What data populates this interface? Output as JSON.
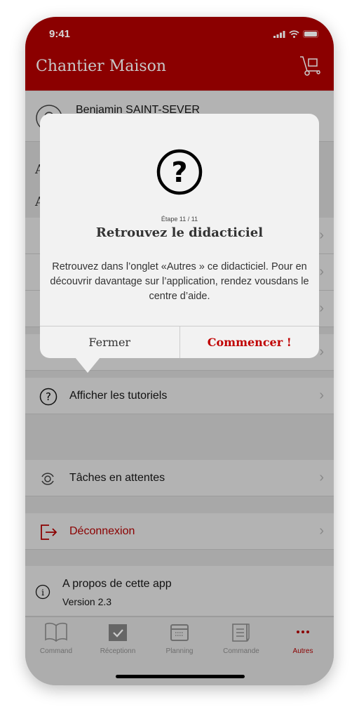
{
  "status": {
    "time": "9:41"
  },
  "header": {
    "title": "Chantier Maison",
    "cart_icon": "cart-icon"
  },
  "user": {
    "name": "Benjamin SAINT-SEVER"
  },
  "sections": [
    "A",
    "A"
  ],
  "menu": {
    "tutorials": "Afficher les tutoriels",
    "pending": "Tâches en attentes",
    "logout": "Déconnexion",
    "about": "A propos de cette app",
    "version": "Version 2.3"
  },
  "dialog": {
    "step": "Étape 11 / 11",
    "title": "Retrouvez le didacticiel",
    "body": "Retrouvez dans l’onglet «Autres » ce didacticiel. Pour en découvrir davantage sur l’application, rendez vousdans le centre d’aide.",
    "close": "Fermer",
    "start": "Commencer !"
  },
  "tabs": [
    {
      "label": "Command",
      "icon": "book-icon"
    },
    {
      "label": "Réceptionn",
      "icon": "calendar-check-icon"
    },
    {
      "label": "Planning",
      "icon": "calendar-icon"
    },
    {
      "label": "Commande",
      "icon": "notepad-icon"
    },
    {
      "label": "Autres",
      "icon": "more-icon"
    }
  ],
  "colors": {
    "brand": "#8b0000",
    "accent": "#c00000",
    "logout": "#8b0000"
  }
}
